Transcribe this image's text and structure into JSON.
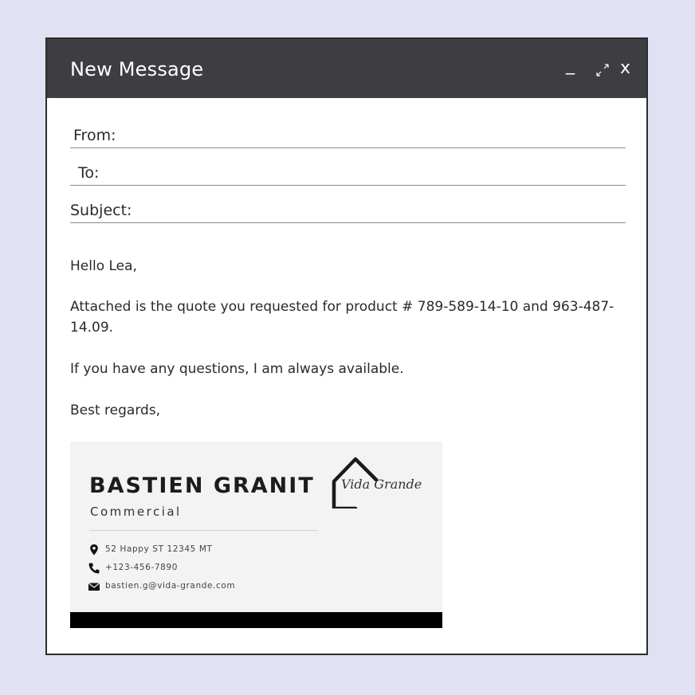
{
  "window": {
    "title": "New Message",
    "controls": {
      "minimize": "_",
      "close": "x"
    }
  },
  "fields": {
    "from_label": "From:",
    "to_label": "To:",
    "subject_label": "Subject:",
    "from_value": "",
    "to_value": "",
    "subject_value": ""
  },
  "body": {
    "greeting": "Hello Lea,",
    "line1": "Attached is the quote you requested for product # 789-589-14-10 and 963-487-14.09.",
    "line2": "If you have any questions, I am always available.",
    "closing": "Best regards,"
  },
  "signature": {
    "name": "BASTIEN GRANIT",
    "role": "Commercial",
    "address": "52 Happy ST 12345 MT",
    "phone": "+123-456-7890",
    "email": "bastien.g@vida-grande.com",
    "logo_text": "Vida Grande"
  },
  "colors": {
    "background": "#e0e1f3",
    "titlebar": "#3e3e42",
    "signature_bg": "#f3f3f3"
  },
  "icons": [
    "expand-icon",
    "location-pin-icon",
    "phone-icon",
    "envelope-icon",
    "house-logo-icon"
  ]
}
